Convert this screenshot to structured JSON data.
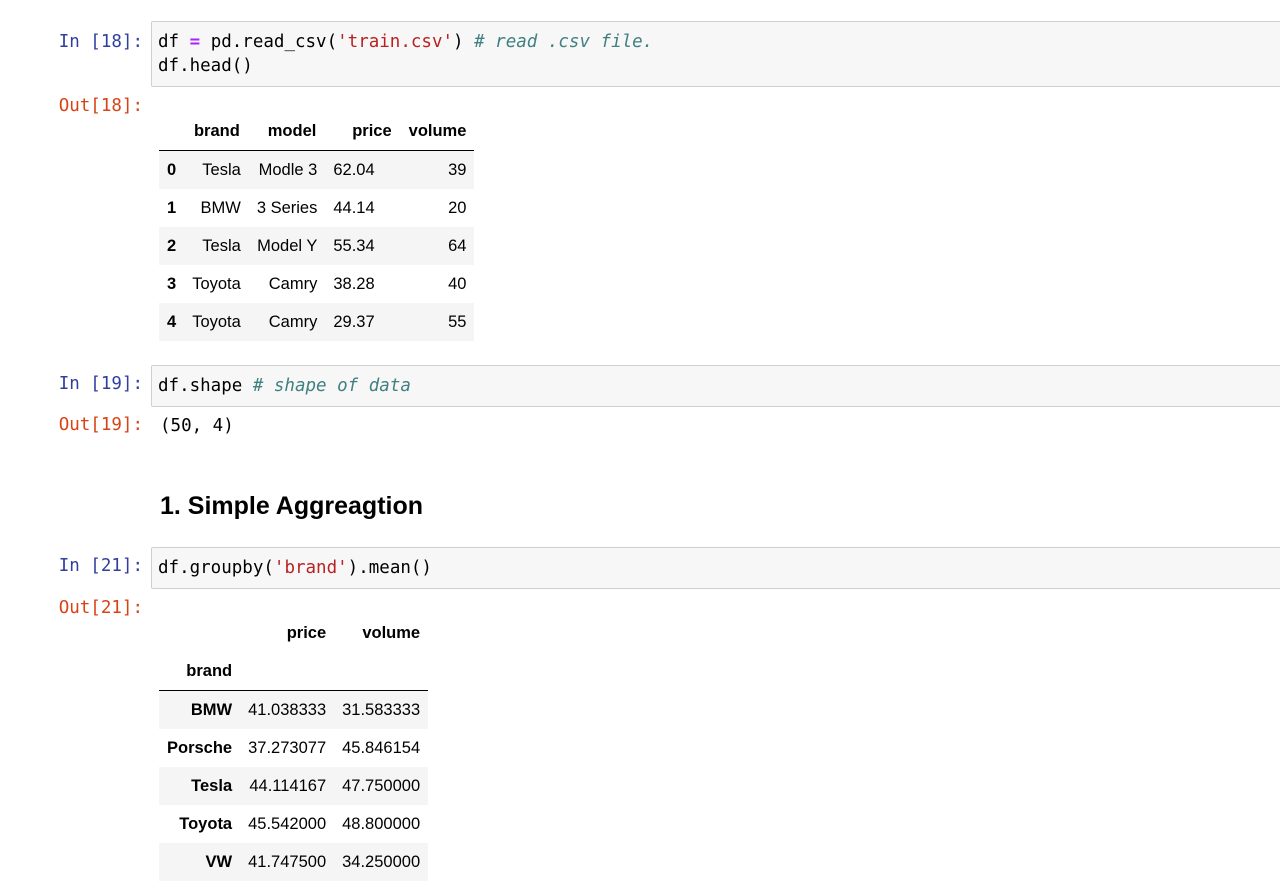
{
  "cells": [
    {
      "in_prompt": "In [18]:",
      "out_prompt": "Out[18]:",
      "code_lines": [
        [
          {
            "t": "df ",
            "c": ""
          },
          {
            "t": "=",
            "c": "op"
          },
          {
            "t": " pd.read_csv(",
            "c": ""
          },
          {
            "t": "'train.csv'",
            "c": "str"
          },
          {
            "t": ") ",
            "c": ""
          },
          {
            "t": "# read .csv file.",
            "c": "com"
          }
        ],
        [
          {
            "t": "df.head()",
            "c": ""
          }
        ]
      ],
      "table": {
        "columns": [
          "",
          "brand",
          "model",
          "price",
          "volume"
        ],
        "rows": [
          {
            "index": "0",
            "cells": [
              "Tesla",
              "Modle 3",
              "62.04",
              "39"
            ]
          },
          {
            "index": "1",
            "cells": [
              "BMW",
              "3 Series",
              "44.14",
              "20"
            ]
          },
          {
            "index": "2",
            "cells": [
              "Tesla",
              "Model Y",
              "55.34",
              "64"
            ]
          },
          {
            "index": "3",
            "cells": [
              "Toyota",
              "Camry",
              "38.28",
              "40"
            ]
          },
          {
            "index": "4",
            "cells": [
              "Toyota",
              "Camry",
              "29.37",
              "55"
            ]
          }
        ]
      }
    },
    {
      "in_prompt": "In [19]:",
      "out_prompt": "Out[19]:",
      "code_lines": [
        [
          {
            "t": "df.shape ",
            "c": ""
          },
          {
            "t": "# shape of data",
            "c": "com"
          }
        ]
      ],
      "output_text": "(50, 4)"
    },
    {
      "in_prompt": "In [21]:",
      "out_prompt": "Out[21]:",
      "code_lines": [
        [
          {
            "t": "df.groupby(",
            "c": ""
          },
          {
            "t": "'brand'",
            "c": "str"
          },
          {
            "t": ").mean()",
            "c": ""
          }
        ]
      ],
      "table": {
        "columns": [
          "",
          "price",
          "volume"
        ],
        "index_name": "brand",
        "rows": [
          {
            "index": "BMW",
            "cells": [
              "41.038333",
              "31.583333"
            ]
          },
          {
            "index": "Porsche",
            "cells": [
              "37.273077",
              "45.846154"
            ]
          },
          {
            "index": "Tesla",
            "cells": [
              "44.114167",
              "47.750000"
            ]
          },
          {
            "index": "Toyota",
            "cells": [
              "45.542000",
              "48.800000"
            ]
          },
          {
            "index": "VW",
            "cells": [
              "41.747500",
              "34.250000"
            ]
          }
        ]
      }
    }
  ],
  "markdown": {
    "heading": "1. Simple Aggreagtion"
  },
  "colors": {
    "in_prompt": "#303f9f",
    "out_prompt": "#d84315",
    "string": "#ba2121",
    "comment": "#408080",
    "operator": "#aa22ff"
  }
}
